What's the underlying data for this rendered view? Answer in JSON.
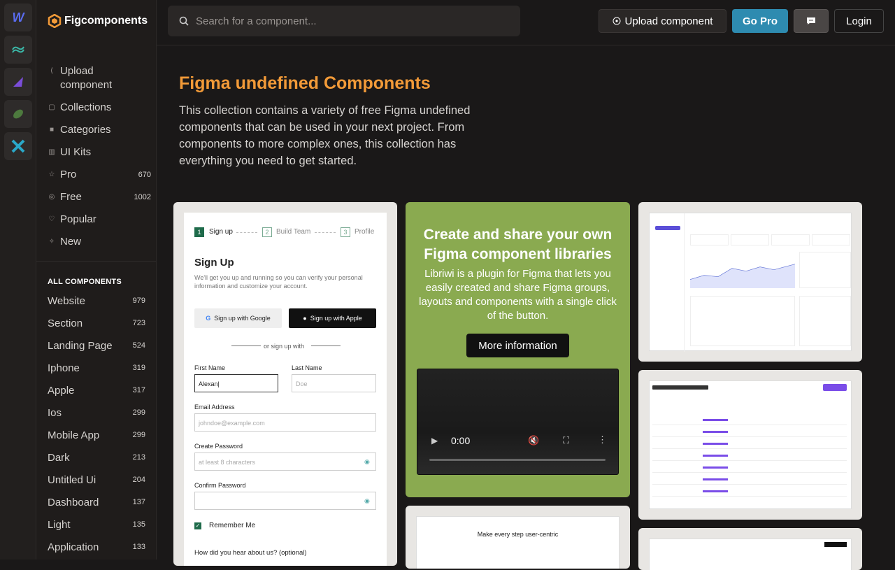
{
  "brand": {
    "name": "Figcomponents",
    "accent": "#f29a38"
  },
  "search": {
    "placeholder": "Search for a component..."
  },
  "header": {
    "upload_label": "Upload component",
    "pro_label": "Go Pro",
    "login_label": "Login"
  },
  "nav": [
    {
      "label": "Upload component",
      "icon": "share-icon"
    },
    {
      "label": "Collections",
      "icon": "lock-icon"
    },
    {
      "label": "Categories",
      "icon": "square-icon"
    },
    {
      "label": "UI Kits",
      "icon": "kit-icon"
    },
    {
      "label": "Pro",
      "icon": "star-icon",
      "count": "670"
    },
    {
      "label": "Free",
      "icon": "gift-icon",
      "count": "1002"
    },
    {
      "label": "Popular",
      "icon": "heart-icon"
    },
    {
      "label": "New",
      "icon": "sparkle-icon"
    }
  ],
  "all_components_title": "ALL COMPONENTS",
  "categories": [
    {
      "label": "Website",
      "count": "979"
    },
    {
      "label": "Section",
      "count": "723"
    },
    {
      "label": "Landing Page",
      "count": "524"
    },
    {
      "label": "Iphone",
      "count": "319"
    },
    {
      "label": "Apple",
      "count": "317"
    },
    {
      "label": "Ios",
      "count": "299"
    },
    {
      "label": "Mobile App",
      "count": "299"
    },
    {
      "label": "Dark",
      "count": "213"
    },
    {
      "label": "Untitled Ui",
      "count": "204"
    },
    {
      "label": "Dashboard",
      "count": "137"
    },
    {
      "label": "Light",
      "count": "135"
    },
    {
      "label": "Application",
      "count": "133"
    }
  ],
  "hero": {
    "title": "Figma undefined Components",
    "description": "This collection contains a variety of free Figma undefined components that can be used in your next project. From components to more complex ones, this collection has everything you need to get started."
  },
  "promo": {
    "title": "Create and share your own Figma component libraries",
    "body": "Libriwi is a plugin for Figma that lets you easily created and share Figma groups, layouts and components with a single click of the button.",
    "cta": "More information",
    "video_time": "0:00"
  },
  "signup_card": {
    "steps": [
      "Sign up",
      "Build Team",
      "Profile"
    ],
    "title": "Sign Up",
    "subtitle": "We'll get you up and running so you can verify your personal information and customize your account.",
    "google": "Sign up with Google",
    "apple": "Sign up with Apple",
    "divider": "or sign up with",
    "first_name_label": "First Name",
    "first_name_value": "Alexan|",
    "last_name_label": "Last Name",
    "last_name_placeholder": "Doe",
    "email_label": "Email Address",
    "email_placeholder": "johndoe@example.com",
    "password_label": "Create Password",
    "password_placeholder": "at least 8 characters",
    "confirm_label": "Confirm Password",
    "remember": "Remember Me",
    "hear": "How did you hear about us? (optional)"
  },
  "journey_card": {
    "title": "Make every step user-centric"
  }
}
